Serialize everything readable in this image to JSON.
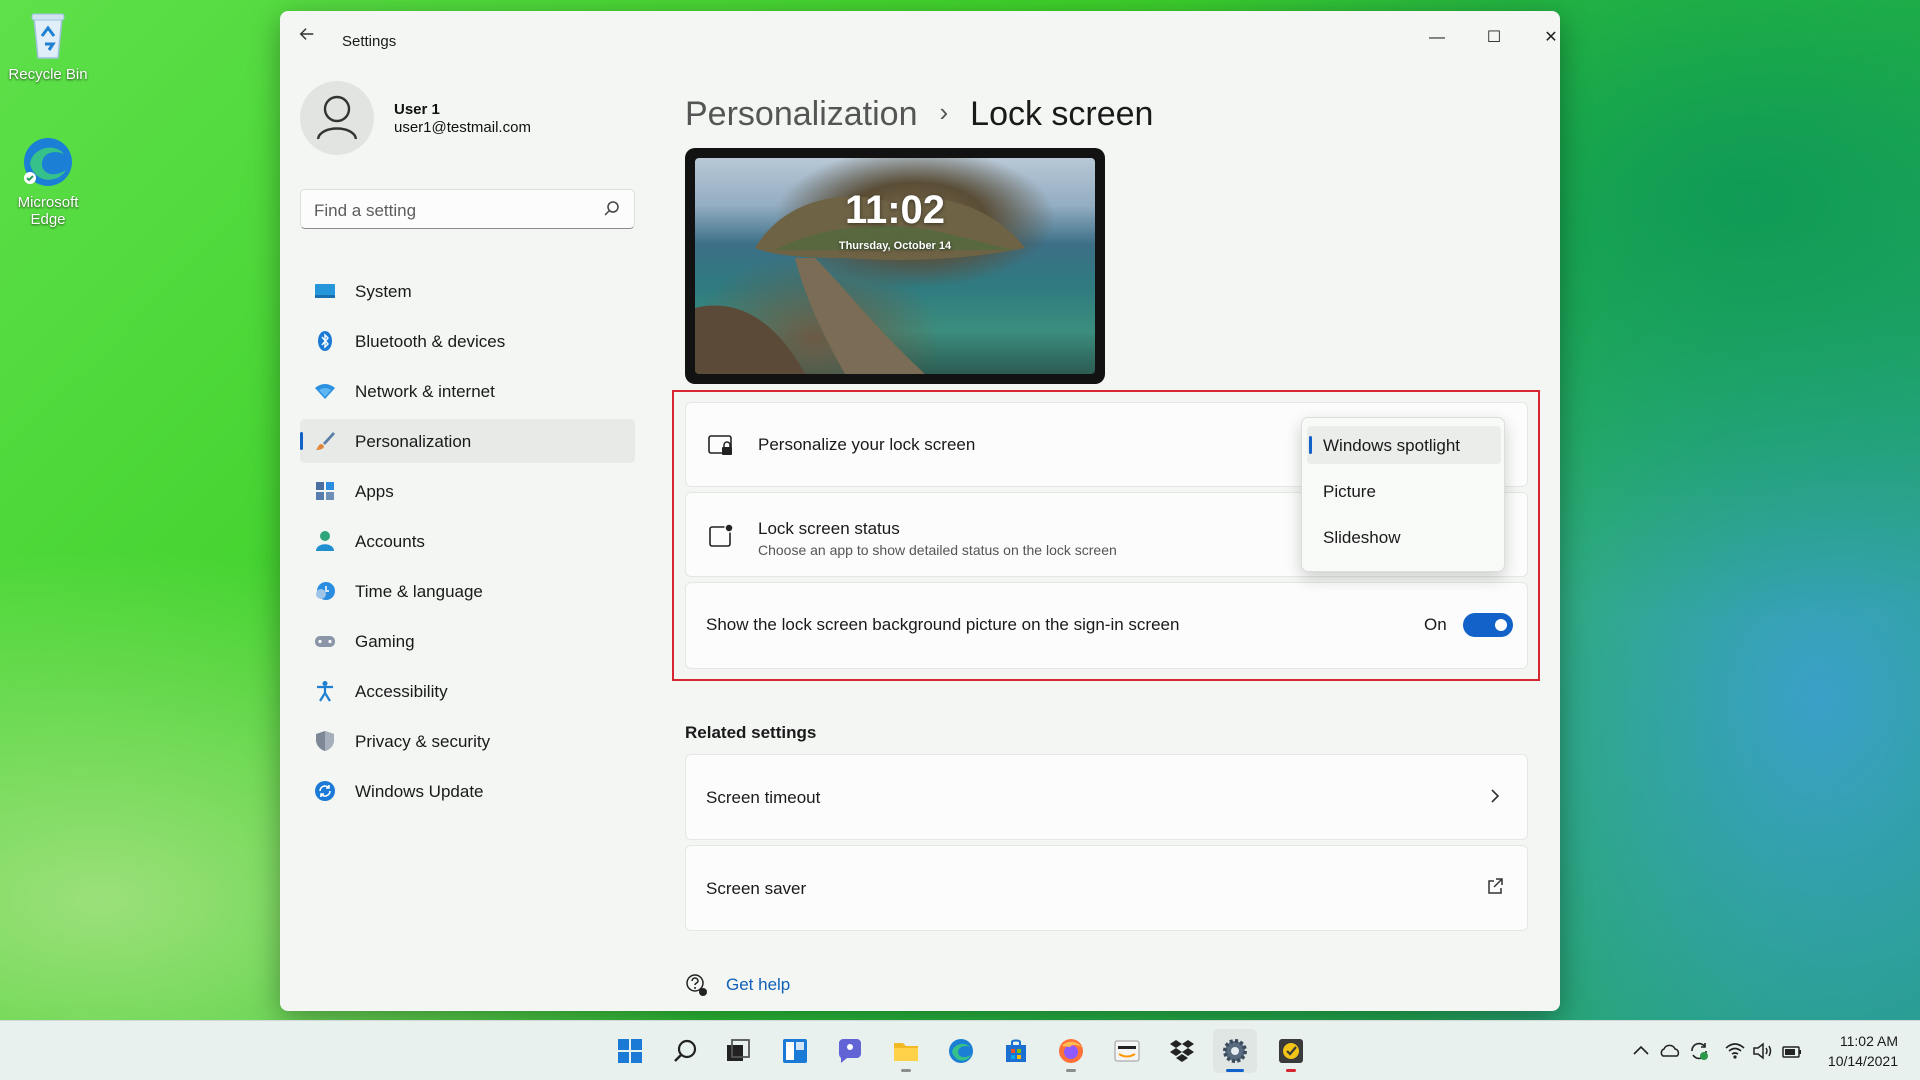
{
  "desktop": {
    "icons": [
      {
        "label": "Recycle Bin"
      },
      {
        "label": "Microsoft Edge"
      }
    ]
  },
  "window": {
    "title": "Settings",
    "controls": {
      "minimize": "—",
      "maximize": "☐",
      "close": "✕"
    }
  },
  "profile": {
    "name": "User 1",
    "email": "user1@testmail.com"
  },
  "search": {
    "placeholder": "Find a setting"
  },
  "sidebar": {
    "items": [
      {
        "label": "System",
        "icon": "system-icon"
      },
      {
        "label": "Bluetooth & devices",
        "icon": "bluetooth-icon"
      },
      {
        "label": "Network & internet",
        "icon": "network-icon"
      },
      {
        "label": "Personalization",
        "icon": "brush-icon",
        "active": true
      },
      {
        "label": "Apps",
        "icon": "apps-icon"
      },
      {
        "label": "Accounts",
        "icon": "accounts-icon"
      },
      {
        "label": "Time & language",
        "icon": "time-language-icon"
      },
      {
        "label": "Gaming",
        "icon": "gaming-icon"
      },
      {
        "label": "Accessibility",
        "icon": "accessibility-icon"
      },
      {
        "label": "Privacy & security",
        "icon": "shield-icon"
      },
      {
        "label": "Windows Update",
        "icon": "update-icon"
      }
    ]
  },
  "breadcrumb": {
    "parent": "Personalization",
    "separator": "›",
    "current": "Lock screen"
  },
  "preview": {
    "time": "11:02",
    "date": "Thursday, October 14"
  },
  "settings": {
    "personalize": {
      "title": "Personalize your lock screen",
      "options": [
        "Windows spotlight",
        "Picture",
        "Slideshow"
      ],
      "selected": "Windows spotlight"
    },
    "status": {
      "title": "Lock screen status",
      "subtitle": "Choose an app to show detailed status on the lock screen"
    },
    "signin_bg": {
      "title": "Show the lock screen background picture on the sign-in screen",
      "state": "On"
    }
  },
  "related": {
    "title": "Related settings",
    "items": [
      {
        "label": "Screen timeout",
        "trail": "chevron-right-icon"
      },
      {
        "label": "Screen saver",
        "trail": "external-link-icon"
      }
    ]
  },
  "help": {
    "get_help": "Get help"
  },
  "taskbar": {
    "apps": [
      "start",
      "search",
      "task-view",
      "widgets",
      "teams-chat",
      "file-explorer",
      "edge",
      "store",
      "firefox",
      "amazon",
      "dropbox",
      "settings",
      "todo"
    ],
    "clock_time": "11:02 AM",
    "clock_date": "10/14/2021"
  },
  "colors": {
    "accent": "#1262c9",
    "highlight_border": "#d6262f",
    "link": "#1260b8"
  }
}
